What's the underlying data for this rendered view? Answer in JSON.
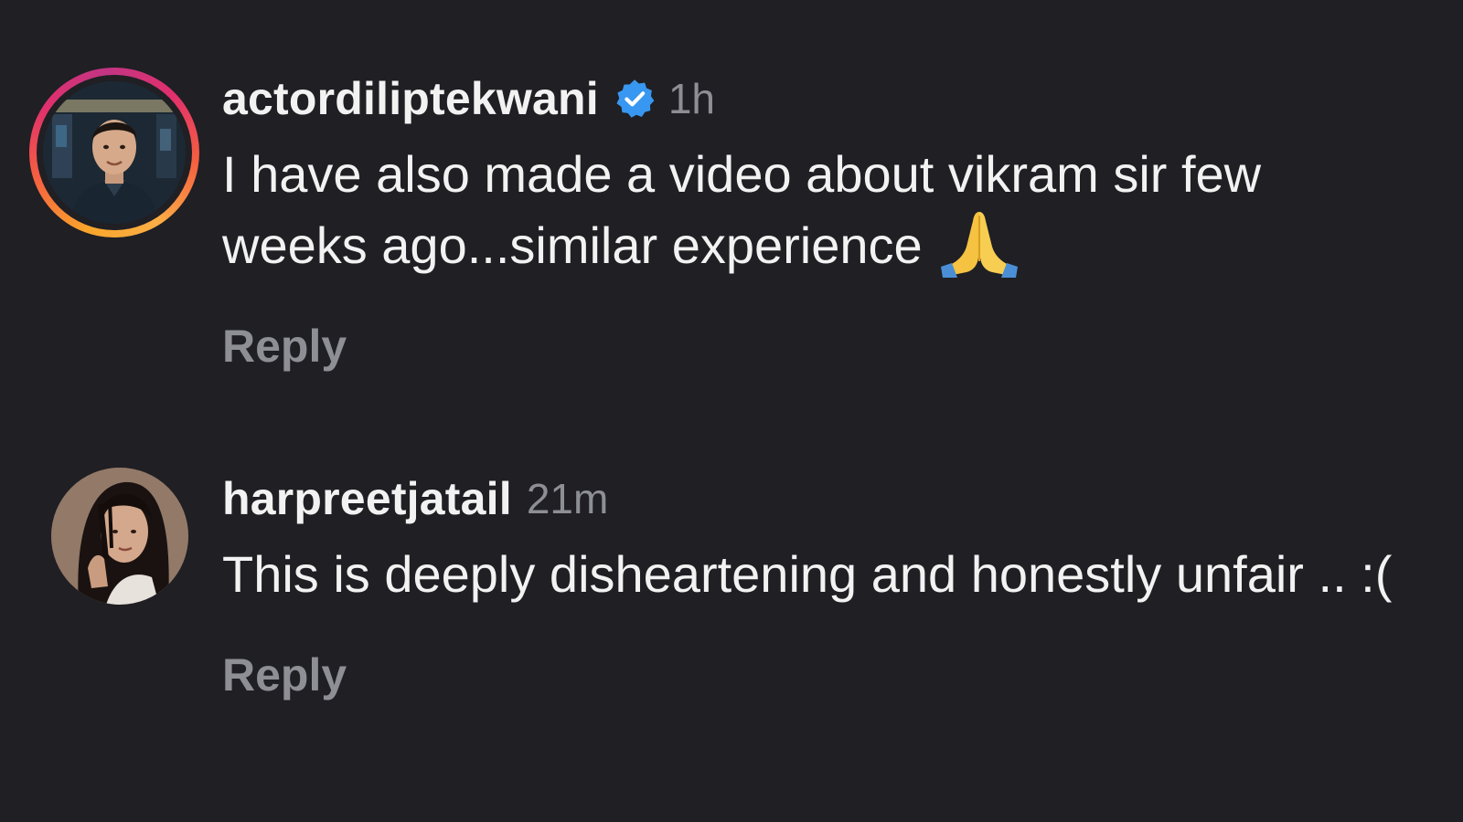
{
  "comments": [
    {
      "username": "actordiliptekwani",
      "verified": true,
      "time": "1h",
      "text": "I have also made a video about vikram sir few weeks ago...similar experience",
      "emoji": "🙏",
      "reply_label": "Reply",
      "avatar_has_story_ring": true
    },
    {
      "username": "harpreetjatail",
      "verified": false,
      "time": "21m",
      "text": "This is deeply disheartening and honestly unfair .. :(",
      "reply_label": "Reply",
      "avatar_has_story_ring": false
    }
  ],
  "colors": {
    "background": "#1f1f24",
    "text": "#f2f2f2",
    "muted": "#8e8e95",
    "verified_badge": "#3897f0"
  }
}
